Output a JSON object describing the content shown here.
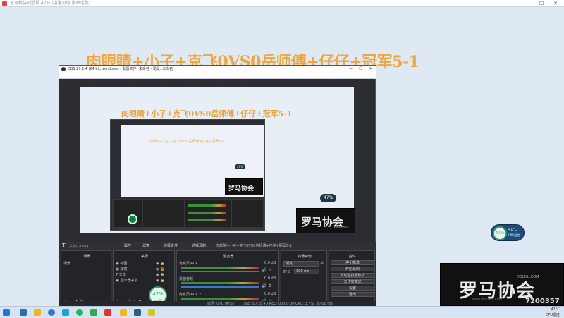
{
  "outer_window": {
    "title": "鲁迅精装别墅号 47万 (温馨分组 推举话题)"
  },
  "overlay": {
    "title": "肉眼睛+小子+克飞0VS0岳师傅+仔仔+冠军5-1"
  },
  "obs": {
    "title": "OBS 27.2.4 (64 bit, windows) - 配置文件: 未命名 - 场景: 未命名",
    "menu": [
      "文件(F)",
      "编辑(E)",
      "视图(V)",
      "停靠窗口(D)",
      "配置文件(P)",
      "场景集合(S)",
      "工具(T)",
      "帮助(H)"
    ],
    "nested_title": "肉眼睛+小子+克飞0VS0岳师傅+仔仔+冠军5-1",
    "text_source_prefix": "T",
    "text_source_value": "文本(GDI+)",
    "docks": {
      "scenes": "场景",
      "sources": "来源",
      "mixer": "混音器",
      "transitions": "转场特效",
      "controls": "控件"
    },
    "scene_items": [
      "场景"
    ],
    "source_items": [
      "截图",
      "滤镜",
      "文本",
      "显示器采集"
    ],
    "source_prefixes": [
      "▣",
      "▣",
      "T",
      "▣"
    ],
    "mixer_items": [
      {
        "name": "麦克风/Aux",
        "db": "0.0 dB"
      },
      {
        "name": "桌面音频",
        "db": "0.0 dB"
      },
      {
        "name": "麦克风/Aux 2",
        "db": "0.0 dB"
      }
    ],
    "transition": {
      "type": "渐变",
      "duration_label": "时长",
      "duration": "300 ms"
    },
    "controls": [
      "停止推流",
      "开始录制",
      "启动虚拟摄像机",
      "工作室模式",
      "设置",
      "退出"
    ],
    "toolbar": [
      "属性",
      "滤镜",
      "选择文件",
      "选择源的"
    ],
    "stream_key": "肉眼睛+小子+克飞0VS0岳师傅+仔仔+冠军5-1",
    "status": "LIVE: 00:35:40   REC: 00:00:00   CPU: 3.7%, 30.00 fps",
    "dropped": "延迟: 0 (0.00%)",
    "gauge": "47%",
    "gauge_sub": "CPU温度"
  },
  "logo": {
    "text": "罗马协会",
    "sub": "DOUYU.COM",
    "room": "7200357",
    "url": "www.lmxhcs.com"
  },
  "desktop_gauge": {
    "value": "47%",
    "temp": "41°C",
    "label": "CPU温度"
  },
  "pill": {
    "text": "47%"
  },
  "taskbar": {
    "tray_temp": "41°C",
    "tray_label": "CPU温度"
  }
}
